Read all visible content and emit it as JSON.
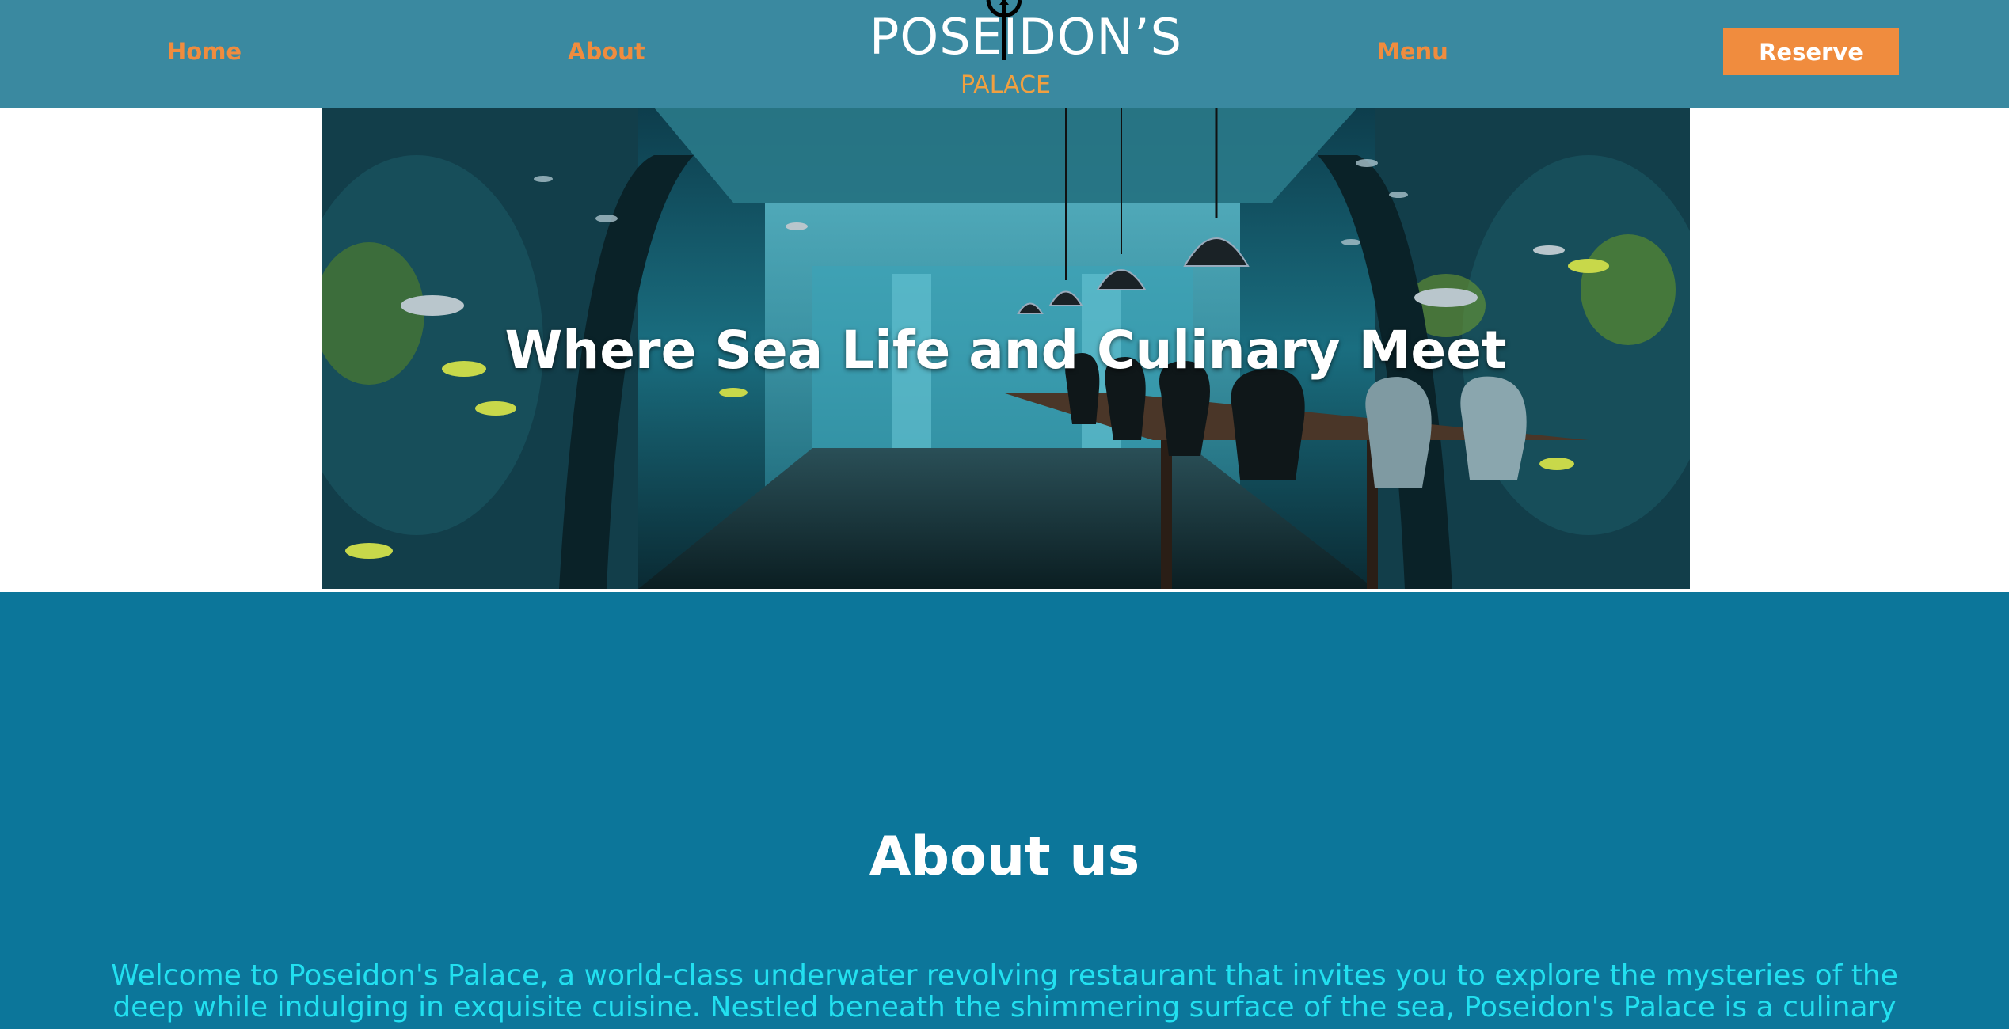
{
  "nav": {
    "home": "Home",
    "about": "About",
    "menu": "Menu",
    "reserve": "Reserve"
  },
  "logo": {
    "title": "POSEIDON’S",
    "subtitle": "PALACE"
  },
  "hero": {
    "title": "Where Sea Life and Culinary Meet",
    "image": "underwater-restaurant-image"
  },
  "about": {
    "heading": "About us",
    "text": "Welcome to Poseidon's Palace, a world-class underwater revolving restaurant that invites you to explore the mysteries of the deep while indulging in exquisite cuisine. Nestled beneath the shimmering surface of the sea, Poseidon's Palace is a culinary"
  },
  "colors": {
    "navbar": "#3a89a0",
    "accent": "#f08c3e",
    "section": "#0c769a",
    "about_text": "#22e0f0"
  }
}
